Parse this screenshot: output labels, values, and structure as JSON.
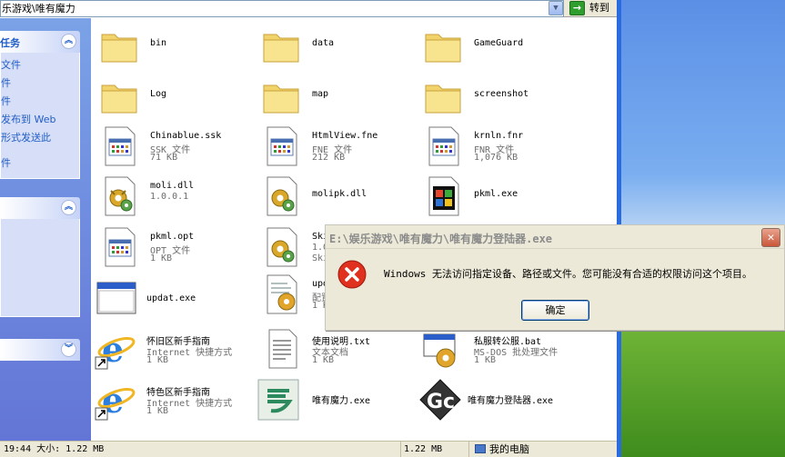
{
  "address": {
    "path": "乐游戏\\唯有魔力",
    "go_label": "转到"
  },
  "left_pane": {
    "panel1": {
      "title": "任务",
      "items": [
        "文件",
        "件",
        "件",
        "发布到 Web",
        "形式发送此",
        "件"
      ]
    },
    "panel2": {
      "title": ""
    },
    "panel3": {
      "title": ""
    }
  },
  "files": [
    {
      "name": "bin",
      "icon": "folder-icon"
    },
    {
      "name": "data",
      "icon": "folder-icon"
    },
    {
      "name": "GameGuard",
      "icon": "folder-icon"
    },
    {
      "name": "Log",
      "icon": "folder-icon"
    },
    {
      "name": "map",
      "icon": "folder-icon"
    },
    {
      "name": "screenshot",
      "icon": "folder-icon"
    },
    {
      "name": "Chinablue.ssk",
      "type": "SSK 文件",
      "size": "71 KB",
      "icon": "generic-file-icon"
    },
    {
      "name": "HtmlView.fne",
      "type": "FNE 文件",
      "size": "212 KB",
      "icon": "generic-file-icon"
    },
    {
      "name": "krnln.fnr",
      "type": "FNR 文件",
      "size": "1,076 KB",
      "icon": "generic-file-icon"
    },
    {
      "name": "moli.dll",
      "type": "1.0.0.1",
      "icon": "gear-file-icon"
    },
    {
      "name": "molipk.dll",
      "icon": "gear-file-icon"
    },
    {
      "name": "pkml.exe",
      "icon": "windows-exe-icon"
    },
    {
      "name": "pkml.opt",
      "type": "OPT 文件",
      "size": "1 KB",
      "icon": "generic-file-icon"
    },
    {
      "name": "Skin",
      "type": "1.0.",
      "size": "Skin",
      "icon": "gear-file-icon"
    },
    {
      "name": "updat.exe",
      "icon": "app-window-icon"
    },
    {
      "name": "upda",
      "type": "配置",
      "size": "1 KB",
      "icon": "config-file-icon"
    },
    {
      "name": "怀旧区新手指南",
      "type": "Internet 快捷方式",
      "size": "1 KB",
      "icon": "ie-shortcut-icon"
    },
    {
      "name": "使用说明.txt",
      "type": "文本文档",
      "size": "1 KB",
      "icon": "text-file-icon"
    },
    {
      "name": "私服转公服.bat",
      "type": "MS-DOS 批处理文件",
      "size": "1 KB",
      "icon": "batch-file-icon"
    },
    {
      "name": "特色区新手指南",
      "type": "Internet 快捷方式",
      "size": "1 KB",
      "icon": "ie-shortcut-icon"
    },
    {
      "name": "唯有魔力.exe",
      "icon": "game-exe-icon"
    },
    {
      "name": "唯有魔力登陆器.exe",
      "icon": "launcher-exe-icon"
    }
  ],
  "status": {
    "left": "19:44 大小: 1.22 MB",
    "size": "1.22 MB",
    "zone": "我的电脑"
  },
  "dialog": {
    "title": "E:\\娱乐游戏\\唯有魔力\\唯有魔力登陆器.exe",
    "message": "Windows 无法访问指定设备、路径或文件。您可能没有合适的权限访问这个项目。",
    "ok_label": "确定"
  },
  "colors": {
    "titlebar_blue": "#215dc6",
    "task_pane_bg": "#d6dff7",
    "error_red": "#e0301e"
  }
}
